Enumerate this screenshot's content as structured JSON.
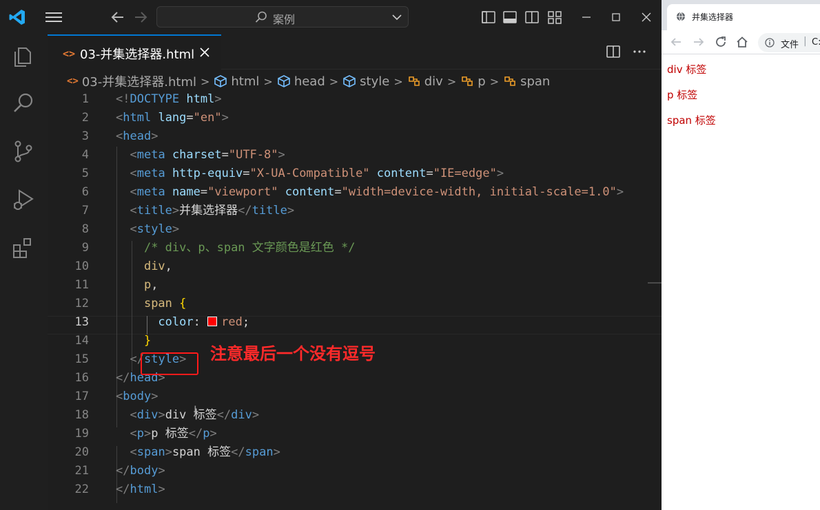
{
  "titlebar": {
    "search_text": "案例"
  },
  "tab": {
    "label": "03-并集选择器.html",
    "icon": "<>"
  },
  "breadcrumb": {
    "items": [
      "03-并集选择器.html",
      "html",
      "head",
      "style",
      "div",
      "p",
      "span"
    ]
  },
  "code": {
    "line_numbers": [
      "1",
      "2",
      "3",
      "4",
      "5",
      "6",
      "7",
      "8",
      "9",
      "10",
      "11",
      "12",
      "13",
      "14",
      "15",
      "16",
      "17",
      "18",
      "19",
      "20",
      "21",
      "22"
    ],
    "active_line": "13",
    "lines": {
      "l1_doctype": "DOCTYPE",
      "l1_html": "html",
      "l2_tag": "html",
      "l2_attr": "lang",
      "l2_val": "\"en\"",
      "l3_tag": "head",
      "l4_tag": "meta",
      "l4_attr": "charset",
      "l4_val": "\"UTF-8\"",
      "l5_tag": "meta",
      "l5_attr1": "http-equiv",
      "l5_val1": "\"X-UA-Compatible\"",
      "l5_attr2": "content",
      "l5_val2": "\"IE=edge\"",
      "l6_tag": "meta",
      "l6_attr1": "name",
      "l6_val1": "\"viewport\"",
      "l6_attr2": "content",
      "l6_val2": "\"width=device-width, initial-scale=1.0\"",
      "l7_tag": "title",
      "l7_text": "并集选择器",
      "l7_close": "title",
      "l8_tag": "style",
      "l9_comment": "/* div、p、span 文字颜色是红色 */",
      "l10_sel": "div",
      "l10_punct": ",",
      "l11_sel": "p",
      "l11_punct": ",",
      "l12_sel": "span",
      "l12_brace": "{",
      "l13_prop": "color",
      "l13_colon": ":",
      "l13_value": "red",
      "l13_semi": ";",
      "l14_brace": "}",
      "l15_close": "style",
      "l16_close": "head",
      "l17_tag": "body",
      "l18_tag": "div",
      "l18_text": "div 标签",
      "l18_close": "div",
      "l19_tag": "p",
      "l19_text": "p 标签",
      "l19_close": "p",
      "l20_tag": "span",
      "l20_text": "span 标签",
      "l20_close": "span",
      "l21_close": "body",
      "l22_close": "html"
    }
  },
  "annotation": {
    "text": "注意最后一个没有逗号",
    "color": "#ff1a1a"
  },
  "browser": {
    "tab_title": "并集选择器",
    "omnibox_label": "文件",
    "omnibox_url": "C:",
    "content": [
      "div 标签",
      "p 标签",
      "span 标签"
    ],
    "content_color": "#c00000"
  },
  "colors": {
    "accent": "#0078d4",
    "html_icon": "#e37933"
  }
}
